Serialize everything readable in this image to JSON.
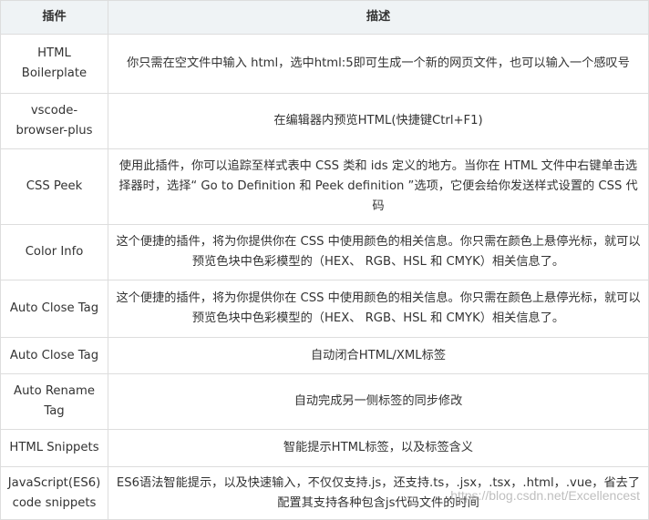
{
  "table": {
    "headers": [
      "插件",
      "描述"
    ],
    "rows": [
      {
        "name": "HTML Boilerplate",
        "desc": "你只需在空文件中输入 html，选中html:5即可生成一个新的网页文件，也可以输入一个感叹号"
      },
      {
        "name": "vscode-browser-plus",
        "desc": "在编辑器内预览HTML(快捷键Ctrl+F1)"
      },
      {
        "name": "CSS Peek",
        "desc": "使用此插件，你可以追踪至样式表中 CSS 类和 ids 定义的地方。当你在 HTML 文件中右键单击选择器时，选择“ Go to Definition 和 Peek definition ”选项，它便会给你发送样式设置的 CSS 代码"
      },
      {
        "name": "Color Info",
        "desc": "这个便捷的插件，将为你提供你在 CSS 中使用颜色的相关信息。你只需在颜色上悬停光标，就可以预览色块中色彩模型的（HEX、 RGB、HSL 和 CMYK）相关信息了。"
      },
      {
        "name": "Auto Close Tag",
        "desc": "这个便捷的插件，将为你提供你在 CSS 中使用颜色的相关信息。你只需在颜色上悬停光标，就可以预览色块中色彩模型的（HEX、 RGB、HSL 和 CMYK）相关信息了。"
      },
      {
        "name": "Auto Close Tag",
        "desc": "自动闭合HTML/XML标签"
      },
      {
        "name": "Auto Rename Tag",
        "desc": "自动完成另一侧标签的同步修改"
      },
      {
        "name": "HTML Snippets",
        "desc": "智能提示HTML标签，以及标签含义"
      },
      {
        "name": "JavaScript(ES6) code snippets",
        "desc": "ES6语法智能提示，以及快速输入，不仅仅支持.js，还支持.ts，.jsx，.tsx，.html，.vue，省去了配置其支持各种包含js代码文件的时间"
      }
    ]
  },
  "watermark": "https://blog.csdn.net/Excellencest"
}
